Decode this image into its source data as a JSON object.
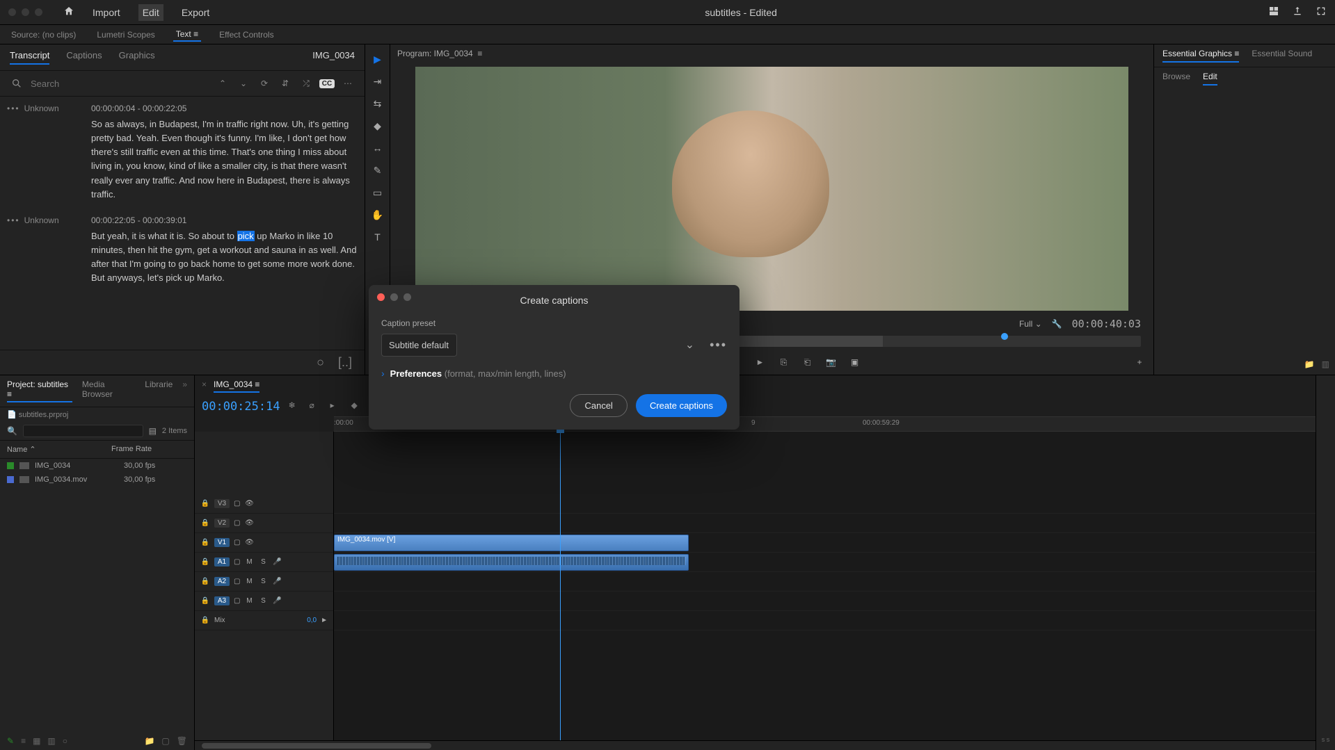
{
  "window_title": "subtitles - Edited",
  "top_menu": {
    "import": "Import",
    "edit": "Edit",
    "export": "Export"
  },
  "sec_bar": {
    "source": "Source: (no clips)",
    "lumetri": "Lumetri Scopes",
    "text": "Text",
    "effect_controls": "Effect Controls",
    "program_label": "Program: IMG_0034",
    "eg": "Essential Graphics",
    "es": "Essential Sound"
  },
  "transcript": {
    "tabs": {
      "transcript": "Transcript",
      "captions": "Captions",
      "graphics": "Graphics"
    },
    "sequence": "IMG_0034",
    "search_placeholder": "Search",
    "segments": [
      {
        "speaker": "Unknown",
        "time": "00:00:00:04 - 00:00:22:05",
        "text_before": "So as always, in Budapest, I'm in traffic right now. Uh, it's getting pretty bad. Yeah. Even though it's funny. I'm like, I don't get how there's still traffic even at this time. That's one thing I miss about living in, you know, kind of like a smaller city, is that there wasn't really ever any traffic. And now here in Budapest, there is always traffic.",
        "highlight": "",
        "text_after": ""
      },
      {
        "speaker": "Unknown",
        "time": "00:00:22:05 - 00:00:39:01",
        "text_before": "But yeah, it is what it is. So about to ",
        "highlight": "pick",
        "text_after": " up Marko in like 10 minutes, then hit the gym, get a workout and sauna in as well. And after that I'm going to go back home to get some more work done. But anyways, let's pick up Marko."
      }
    ]
  },
  "eg_panel": {
    "browse": "Browse",
    "edit": "Edit"
  },
  "program": {
    "right_tc": "00:00:40:03",
    "quality": "Full"
  },
  "project": {
    "tabs": {
      "project": "Project: subtitles",
      "media": "Media Browser",
      "libraries": "Librarie"
    },
    "file": "subtitles.prproj",
    "count": "2 Items",
    "cols": {
      "name": "Name",
      "fr": "Frame Rate"
    },
    "items": [
      {
        "name": "IMG_0034",
        "fr": "30,00 fps",
        "color": "#2a8a2a"
      },
      {
        "name": "IMG_0034.mov",
        "fr": "30,00 fps",
        "color": "#4a6ad0"
      }
    ]
  },
  "timeline": {
    "sequence": "IMG_0034",
    "tc": "00:00:25:14",
    "ruler": [
      {
        "pos": 0,
        "label": ":00:00"
      },
      {
        "pos": 370,
        "label": "9"
      },
      {
        "pos": 740,
        "label": "00:00:59:29"
      }
    ],
    "tracks": {
      "video": [
        "V3",
        "V2",
        "V1"
      ],
      "audio": [
        "A1",
        "A2",
        "A3"
      ],
      "mix": "Mix",
      "mix_val": "0,0"
    },
    "clip_name": "IMG_0034.mov [V]"
  },
  "modal": {
    "title": "Create captions",
    "preset_label": "Caption preset",
    "preset_value": "Subtitle default",
    "preferences": "Preferences",
    "preferences_hint": "(format, max/min length, lines)",
    "cancel": "Cancel",
    "create": "Create captions"
  }
}
